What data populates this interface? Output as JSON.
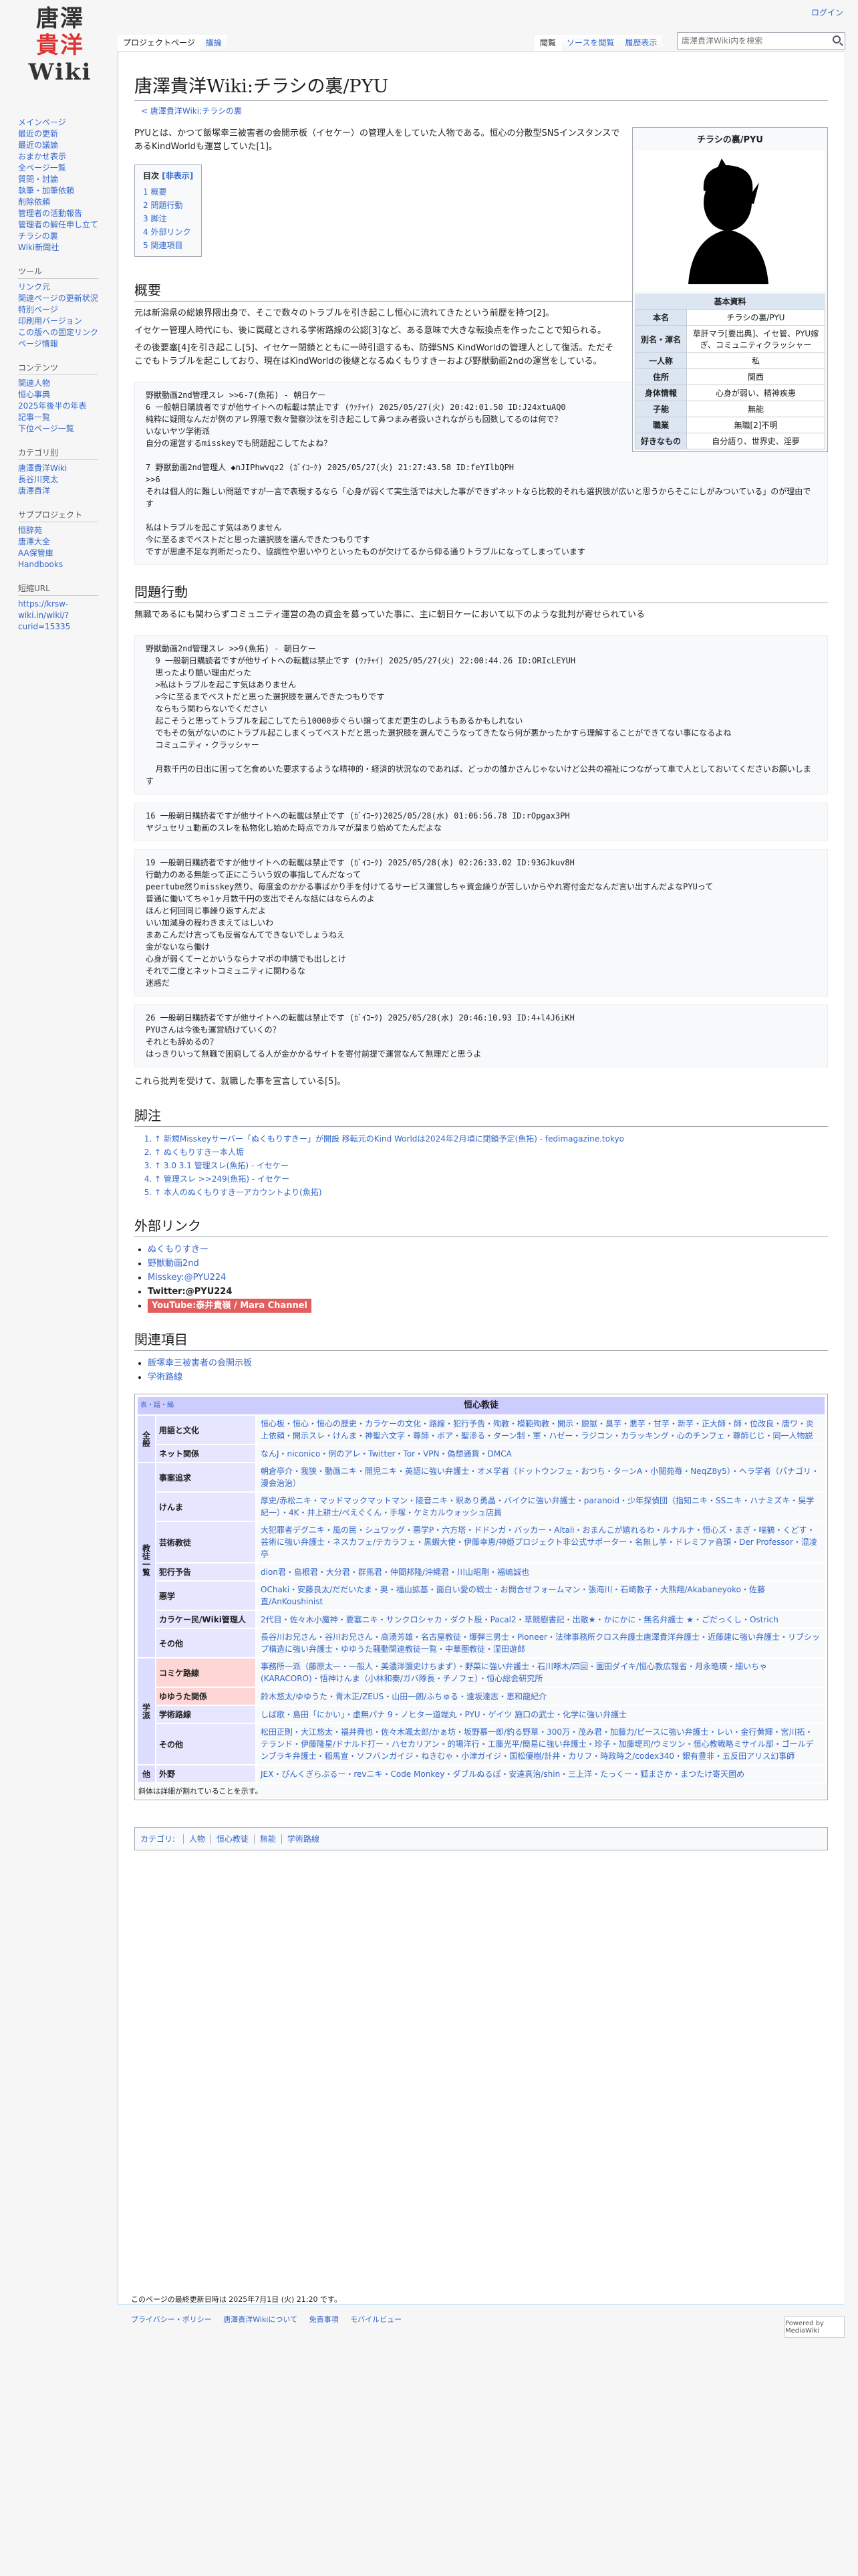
{
  "site": {
    "logo_lines": [
      "唐澤",
      "貴洋",
      "Wiki"
    ]
  },
  "personal": {
    "login": "ログイン"
  },
  "tabs_left": [
    "プロジェクトページ",
    "議論"
  ],
  "tabs_right": [
    "閲覧",
    "ソースを閲覧",
    "履歴表示"
  ],
  "search": {
    "placeholder": "唐澤貴洋Wiki内を検索"
  },
  "sidebar": {
    "main": [
      "メインページ",
      "最近の更新",
      "最近の議論",
      "おまかせ表示",
      "全ページ一覧",
      "質問・討論",
      "執筆・加筆依頼",
      "削除依頼",
      "管理者の活動報告",
      "管理者の解任申し立て",
      "チラシの裏",
      "Wiki新聞社"
    ],
    "tools_title": "ツール",
    "tools": [
      "リンク元",
      "関連ページの更新状況",
      "特別ページ",
      "印刷用バージョン",
      "この版への固定リンク",
      "ページ情報"
    ],
    "contents_title": "コンテンツ",
    "contents": [
      "関連人物",
      "恒心事典",
      "2025年後半の年表",
      "記事一覧",
      "下位ページ一覧"
    ],
    "category_title": "カテゴリ別",
    "category": [
      "唐澤貴洋Wiki",
      "長谷川亮太",
      "唐澤貴洋"
    ],
    "project_title": "サブプロジェクト",
    "project": [
      "恒辞苑",
      "唐澤大全",
      "AA保管庫",
      "Handbooks"
    ],
    "shorturl_title": "短縮URL",
    "shorturl": [
      "https://krsw-",
      "wiki.in/wiki/?",
      "curid=15335"
    ]
  },
  "article": {
    "title": "唐澤貴洋Wiki:チラシの裏/PYU",
    "subtitle": "< 唐澤貴洋Wiki:チラシの裏",
    "intro": "PYUとは、かつて飯塚幸三被害者の会開示板（イセケー）の管理人をしていた人物である。恒心の分散型SNSインスタンスであるKindWorldも運営していた[1]。",
    "toc_title": "目次",
    "toc_toggle": "[非表示]",
    "toc": [
      "1 概要",
      "2 問題行動",
      "3 脚注",
      "4 外部リンク",
      "5 関連項目"
    ],
    "h_summary": "概要",
    "summary_p1": "元は新潟県の総娘界隈出身で、そこで数々のトラブルを引き起こし恒心に流れてきたという前歴を持つ[2]。",
    "summary_p2": "イセケー管理人時代にも、後に罠蔵とされる学術路線の公認[3]など、ある意味で大きな転換点を作ったことで知られる。",
    "summary_p3": "その後要塞[4]を引き起こし[5]、イセケー閉鎖とともに一時引退するも、防弾SNS KindWorldの管理人として復活。ただそこでもトラブルを起こしており、現在はKindWorldの後継となるぬくもりすきーおよび野獣動画2ndの運営をしている。",
    "quote1": "野獣動画2nd管理スレ >>6-7(魚拓) - 朝日ケー\n6 一般朝日購読者ですが他サイトへの転載は禁止です (ｳｧﾁｬｲ) 2025/05/27(火) 20:42:01.50 ID:J24xtuAQ0\n純粋に疑問なんだが例のアレ界隈で数々警察沙汰を引き起こして鼻つまみ者扱いされながらも回数してるのは何で？\nいないヤツ学術派\n自分の運営するmisskeyでも問題起こしてたよね？\n\n7 野獣動画2nd管理人 ◆nJIPhwvqz2 (ｶﾞｲｺｰｸ) 2025/05/27(火) 21:27:43.58 ID:feYIlbQPH\n>>6\nそれは個人的に難しい問題ですが一言で表現するなら「心身が弱くて実生活では大した事ができずネットなら比較的それも選択肢が広いと思うからそこにしがみついている」のが理由です\n\n私はトラブルを起こす気はありません\n今に至るまでベストだと思った選択肢を選んできたつもりです\nですが思慮不足な判断だったり、協調性や思いやりといったものが欠けてるから仰る通りトラブルになってしまっています",
    "h_problems": "問題行動",
    "problems_p": "無職であるにも関わらずコミュニティ運営の為の資金を募っていた事に、主に朝日ケーにおいて以下のような批判が寄せられている",
    "quote2": "野獣動画2nd管理スレ >>9(魚拓) - 朝日ケー\n  9 一般朝日購読者ですが他サイトへの転載は禁止です (ｳｧﾁｬｲ) 2025/05/27(火) 22:00:44.26 ID:ORIcLEYUH\n  思ったより酷い理由だった\n  >私はトラブルを起こす気はありません\n  >今に至るまでベストだと思った選択肢を選んできたつもりです\n  ならもう関わらないでください\n  起こそうと思ってトラブルを起こしてたら10000歩ぐらい譲ってまだ更生のしようもあるかもしれない\n  でもその気がないのにトラブル起こしまくってベストだと思った選択肢を選んでこうなってきたなら何が悪かったかすら理解することができてない事になるよね\n  コミュニティ・クラッシャー\n\n  月数千円の日出に困って乞食めいた要求するような精神的・経済的状況なのであれば、どっかの誰かさんじゃないけど公共の福祉につながって車で人としておいてくださいお願いします",
    "quote3": "16 一般朝日購読者ですが他サイトへの転載は禁止です (ｶﾞｲｺｰｸ)2025/05/28(水) 01:06:56.78 ID:rOpgax3PH\nヤジュセリュ動画のスレを私物化し始めた時点でカルマが溜まり始めてたんだよな",
    "quote4": "19 一般朝日購読者ですが他サイトへの転載は禁止です (ｶﾞｲｺｰｸ) 2025/05/28(水) 02:26:33.02 ID:93GJkuv8H\n行動力のある無能って正にこういう奴の事指してんだなって\npeertube然りmisskey然り、毎度金のかかる事ばかり手を付けてるサービス運営しちゃ資金繰りが苦しいからやれ寄付金だなんだ言い出すんだよなPYUって\n普通に働いてちゃ1ヶ月数千円の支出でそんな話にはならんのよ\nほんと何回同じ事繰り返すんだよ\nいい加減身の程わきまえてはしいわ\nまあこんだけ言っても反省なんてできないでしょうねえ\n金がないなら働け\n心身が弱くてーとかいうならナマポの申請でも出しとけ\nそれで二度とネットコミュニティに関わるな\n迷惑だ",
    "quote5": "26 一般朝日購読者ですが他サイトへの転載は禁止です (ｶﾞｲｺｰｸ) 2025/05/28(水) 20:46:10.93 ID:4+l4J6iKH\nPYUさんは今後も運営続けていくの？\nそれとも辞めるの？\nはっきりいって無職で困窮してる人が金かかるサイトを寄付前提で運営なんて無理だと思うよ",
    "problems_end": "これら批判を受けて、就職した事を宣言している[5]。",
    "h_notes": "脚注",
    "notes": [
      "↑ 新規Misskeyサーバー「ぬくもりすきー」が開設 移転元のKind Worldは2024年2月頃に閉鎖予定(魚拓) - fedimagazine.tokyo",
      "↑ ぬくもりすきー本人垢",
      "↑ 3.0 3.1 管理スレ(魚拓) - イセケー",
      "↑ 管理スレ >>249(魚拓) - イセケー",
      "↑ 本人のぬくもりすきーアカウントより(魚拓)"
    ],
    "h_links": "外部リンク",
    "links": [
      "ぬくもりすきー",
      "野獣動画2nd",
      "Misskey:@PYU224",
      "Twitter:@PYU224",
      "YouTube:泰井貴嶺 / Mara Channel"
    ],
    "h_related": "関連項目",
    "related": [
      "飯塚幸三被害者の会開示板",
      "学術路線"
    ]
  },
  "infobox": {
    "title": "チラシの裏/PYU",
    "section": "基本資料",
    "rows": [
      {
        "k": "本名",
        "v": "チラシの裏/PYU"
      },
      {
        "k": "別名・渾名",
        "v": "草肝マラ[要出典]、イセ管、PYU嫁ぎ、コミュニティクラッシャー"
      },
      {
        "k": "一人称",
        "v": "私"
      },
      {
        "k": "住所",
        "v": "関西"
      },
      {
        "k": "身体情報",
        "v": "心身が弱い、精神疾患"
      },
      {
        "k": "子能",
        "v": "無能"
      },
      {
        "k": "職業",
        "v": "無職[2]不明"
      },
      {
        "k": "好きなもの",
        "v": "自分語り、世界史、淫夢"
      }
    ]
  },
  "navbox": {
    "vte": "表・話・編",
    "title": "恒心教徒",
    "g_all": "全般",
    "g_cult": "教徒一覧",
    "g_school": "学派",
    "g_other": "他",
    "rows": [
      {
        "grp": "g_all",
        "sg": "用語と文化",
        "v": "恒心板・恒心・恒心の歴史・カラケーの文化・路線・犯行予告・殉教・模範殉教・開示・脱獄・臭芋・悪芋・甘芋・新芋・正大師・師・位改良・唐ワ・炎上依頼・開示スレ・けんま・神聖六文字・尊師・ボア・聖滲る・ターン制・軍・ハゼー・ラジコン・カラッキング・心のチンフェ・尊師じじ・同一人物説"
      },
      {
        "grp": "g_all",
        "sg": "ネット関係",
        "v": "なんJ・niconico・例のアレ・Twitter・Tor・VPN・偽想通貨・DMCA"
      },
      {
        "grp": "g_cult",
        "sg": "事案追求",
        "v": "朝倉亭介・我狭・動画ニキ・開児ニキ・英語に強い弁護士・オメ学者（ドットウンフェ・おつち・ターンA・小閲苑苺・NeqZ8y5）・ヘラ学者（パナゴリ・漫会治治）"
      },
      {
        "grp": "g_cult",
        "sg": "けんま",
        "v": "厚史/赤松ニキ・マッドマックマットマン・陵音ニキ・釈あり勇晶・バイクに強い弁護士・paranoid・少年探偵団（指知ニキ・SSニキ・ハナミズキ・吳学紀一）・4K・井上耕士/ぺえぐくん・手塚・ケミカルウォッシュ店員"
      },
      {
        "grp": "g_cult",
        "sg": "芸術教徒",
        "v": "大犯罪者デグニキ・風の民・シュワッグ・悪学P・六方塔・ドドンガ・バッカー・Altali・おまんこが嬉れるわ・ルナルナ・恒心ズ・まぎ・喘鶴・くどす・芸術に強い弁護士・ネスカフェ/テカラフェ・黒蝦大使・伊藤幸恵/神姫プロジェクト非公式サポーター・名無し芋・ドレミファ音頭・Der Professor・混凌亭"
      },
      {
        "grp": "g_cult",
        "sg": "犯行予告",
        "v": "dion君・島根君・大分君・群馬君・仲間邦隆/沖縄君・川山昭剛・福嶋誠也"
      },
      {
        "grp": "g_cult",
        "sg": "悪学",
        "v": "OChaki・安藤良太/だだいたま・奥・福山拡基・面白い愛の戦士・お問合せフォームマン・張海川・石崎教子・大熊翔/Akabaneyoko・佐藤直/AnKoushinist"
      },
      {
        "grp": "g_cult",
        "sg": "カラケー民/Wiki管理人",
        "v": "2代目・佐々木小魔神・要塞ニキ・サンクロシャカ・ダクト股・Pacal2・草競樹書記・出敵★・かにかに・無名弁護士 ★・ごだっくし・Ostrich"
      },
      {
        "grp": "g_cult",
        "sg": "その他",
        "v": "長谷川お兄さん・谷川お兄さん・高湧芳雄・名古屋教徒・爆弾三男士・Pioneer・法律事務所クロス弁護士唐澤貴洋弁護士・近藤建に強い弁護士・リブシップ構造に強い弁護士・ゆゆうた騒動関連教徒一覧・中華圏教徒・湿田遊郎"
      },
      {
        "grp": "g_school",
        "sg": "コミケ路線",
        "v": "事務所一派（藤原太一・一般人・美濃洋彌史けちまず）・野菜に強い弁護士・石川啄木/四回・園田ダイキ/恒心教広報省・月永晧瑛・細いちゃ(KARACORO)・悟神けんま（小林和秦/ガバ隊長・チノフェ）・恒心総会研究所"
      },
      {
        "grp": "g_school",
        "sg": "ゆゆうた関係",
        "v": "鈴木悠太/ゆゆうた・青木正/ZEUS・山田一朗/ふちゅる・遠坂達志・恵和龍紀介"
      },
      {
        "grp": "g_school",
        "sg": "学術路線",
        "v": "しば歌・島田「にかい」・虚無パナ 9・ノヒター道端丸・PYU・ゲイツ 施口の武士・化学に強い弁護士"
      },
      {
        "grp": "g_school",
        "sg": "その他",
        "v": "松田正則・大江悠太・福井舜也・佐々木颯太郎/かぁ坊・坂野慕一郎/釣る野草・300万・茂み君・加藤力/ピースに強い弁護士・レい・金行黄輝・宮川拓・テランド・伊藤隆星/ドナルド打ー・ハセカリアン・的場洋行・工藤光平/簡易に強い弁護士・珍子・加藤堤司/ウミツン・恒心教戦略ミサイル部・ゴールデンブラキ弁護士・稲馬宣・ソフバンガイジ・ねきむゃ・小津ガイジ・国松優樹/計井・カリフ・時政時之/codex340・銀有豊非・五反田アリス幻事師"
      },
      {
        "grp": "g_other",
        "sg": "外野",
        "v": "JEX・ぴんくぎらぶるー・revニキ・Code Monkey・ダブルぬるぽ・安達真治/shin・三上洋・たっくー・狐まさか・まつたけ寄天固め"
      }
    ],
    "foot": "斜体は詳細が割れていることを示す。"
  },
  "categories": {
    "label": "カテゴリ:",
    "items": [
      "人物",
      "恒心教徒",
      "無能",
      "学術路線"
    ]
  },
  "footer": {
    "modified": "このページの最終更新日時は 2025年7月1日 (火) 21:20 です。",
    "links": [
      "プライバシー・ポリシー",
      "唐澤貴洋Wikiについて",
      "免責事項",
      "モバイルビュー"
    ],
    "powered": "Powered by MediaWiki"
  }
}
